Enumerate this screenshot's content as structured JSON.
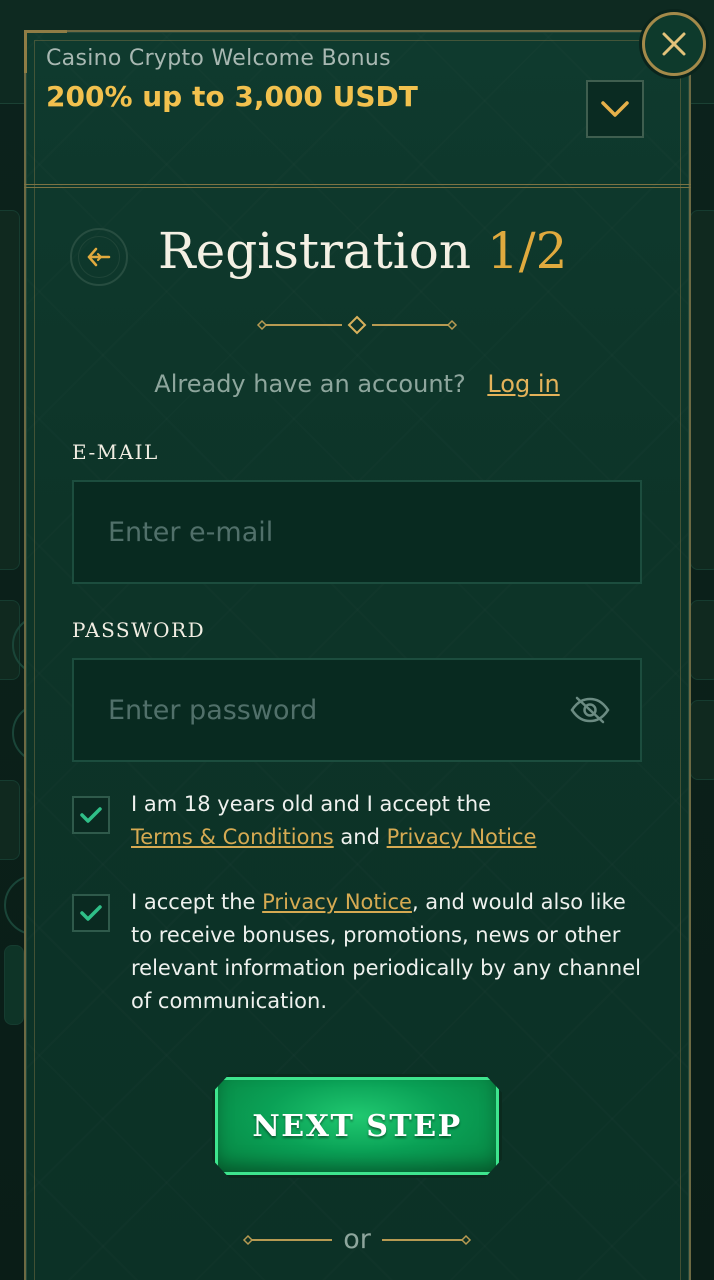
{
  "bonus": {
    "title": "Casino Crypto Welcome Bonus",
    "amount": "200% up to 3,000 USDT"
  },
  "registration": {
    "title": "Registration",
    "step": "1/2"
  },
  "account": {
    "prompt": "Already have an account?",
    "login_label": "Log in"
  },
  "email": {
    "label": "E-MAIL",
    "placeholder": "Enter e-mail",
    "value": ""
  },
  "password": {
    "label": "PASSWORD",
    "placeholder": "Enter password",
    "value": ""
  },
  "consents": [
    {
      "checked": true,
      "text_before": "I am 18 years old and I accept the",
      "link1": "Terms & Conditions",
      "middle": "and",
      "link2": "Privacy Notice"
    },
    {
      "checked": true,
      "text_before": "I accept the",
      "link1": "Privacy Notice",
      "text_after": ", and would also like to receive bonuses, promotions, news or other relevant information periodically by any channel of communication."
    }
  ],
  "next_button": {
    "label": "NEXT STEP"
  },
  "separator": {
    "label": "or"
  },
  "colors": {
    "accent_gold": "#f2c14e",
    "link_gold": "#d6aa52",
    "button_green": "#0aa156",
    "modal_bg": "#0d3428"
  },
  "icons": {
    "close": "close-icon",
    "expand": "chevron-down-icon",
    "back": "back-arrow-icon",
    "password_visibility": "eye-slash-icon",
    "check": "check-icon"
  }
}
